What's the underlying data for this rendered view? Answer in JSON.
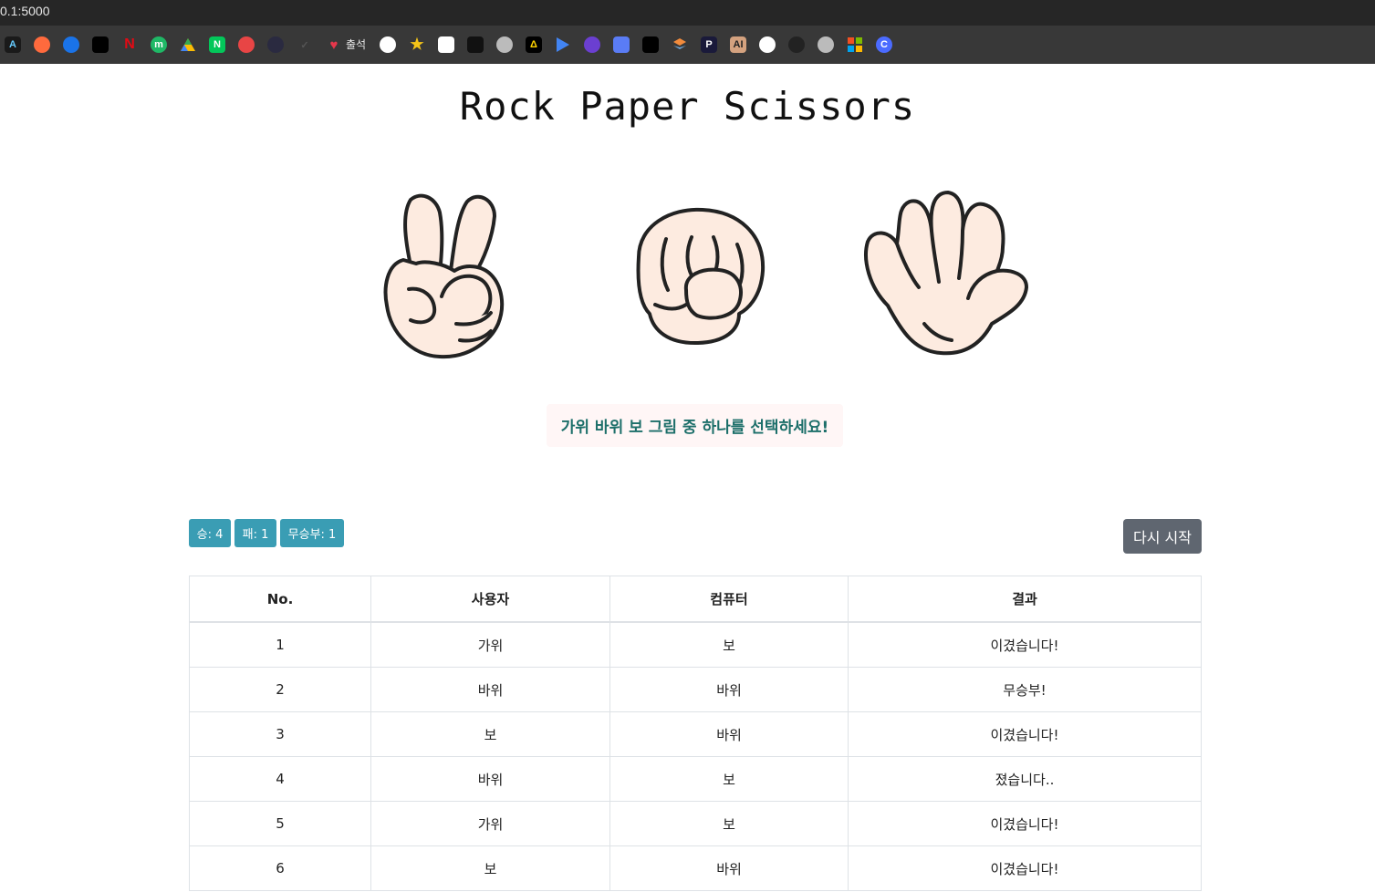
{
  "browser": {
    "url": "0.1:5000",
    "bookmark_label": "출석"
  },
  "page": {
    "title": "Rock Paper Scissors"
  },
  "choices": [
    {
      "name": "가위"
    },
    {
      "name": "바위"
    },
    {
      "name": "보"
    }
  ],
  "message": "가위 바위 보 그림 중 하나를 선택하세요!",
  "score": {
    "win": "승: 4",
    "lose": "패: 1",
    "draw": "무승부: 1"
  },
  "restart_label": "다시 시작",
  "table": {
    "headers": [
      "No.",
      "사용자",
      "컴퓨터",
      "결과"
    ],
    "rows": [
      [
        "1",
        "가위",
        "보",
        "이겼습니다!"
      ],
      [
        "2",
        "바위",
        "바위",
        "무승부!"
      ],
      [
        "3",
        "보",
        "바위",
        "이겼습니다!"
      ],
      [
        "4",
        "바위",
        "보",
        "졌습니다.."
      ],
      [
        "5",
        "가위",
        "보",
        "이겼습니다!"
      ],
      [
        "6",
        "보",
        "바위",
        "이겼습니다!"
      ]
    ]
  },
  "colors": {
    "accent": "#3a9db4",
    "message_text": "#1d6f6a",
    "restart_bg": "#5f6670",
    "hand_fill": "#fdebe0"
  }
}
